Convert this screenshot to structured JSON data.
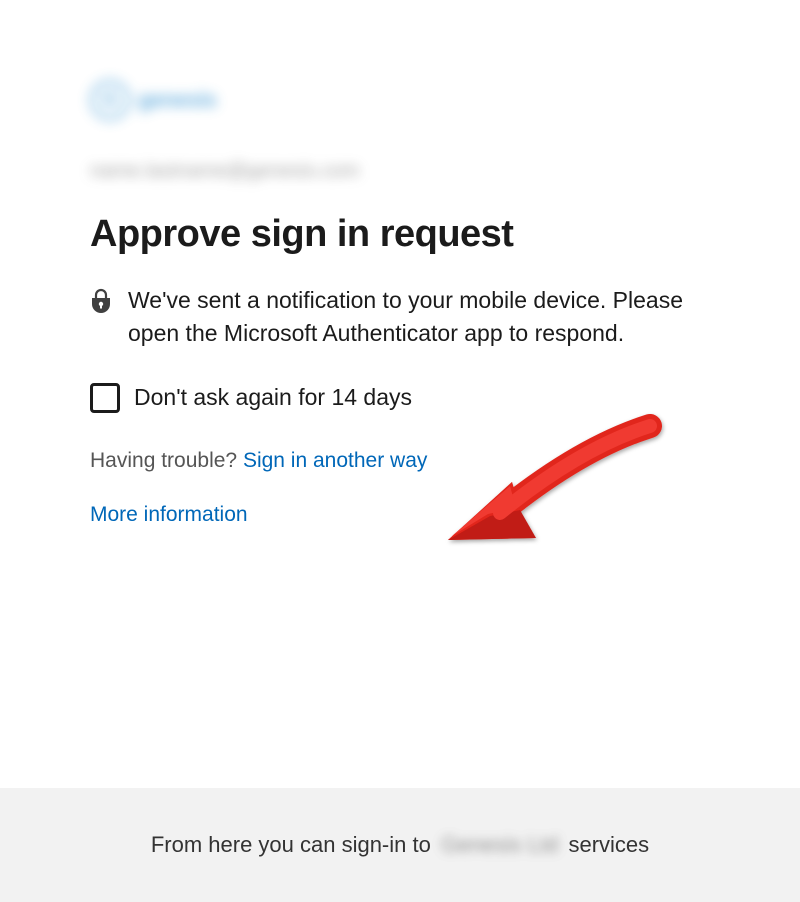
{
  "logo": {
    "brand_text": "genesis"
  },
  "email_placeholder": "name.lastname@genesis.com",
  "heading": "Approve sign in request",
  "message": "We've sent a notification to your mobile device. Please open the Microsoft Authenticator app to respond.",
  "remember": {
    "label": "Don't ask again for 14 days"
  },
  "trouble": {
    "prefix": "Having trouble? ",
    "link": "Sign in another way"
  },
  "more_info_label": "More information",
  "footer": {
    "prefix": "From here you can sign-in to ",
    "org_blur": "Genesis Ltd",
    "suffix": " services"
  },
  "colors": {
    "link": "#0067b8",
    "arrow": "#e1261c"
  }
}
